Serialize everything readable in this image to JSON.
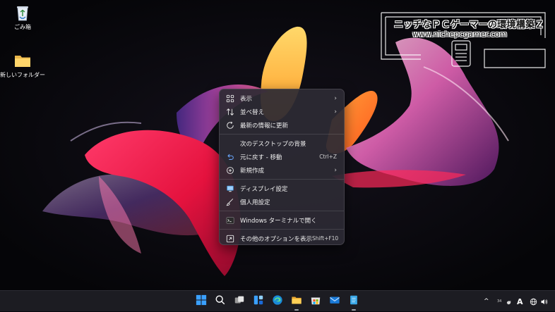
{
  "desktop": {
    "icons": [
      {
        "label": "ごみ箱",
        "icon": "recycle-bin-icon"
      },
      {
        "label": "新しいフォルダー",
        "icon": "folder-icon"
      }
    ]
  },
  "watermark": {
    "title": "ニッチなＰＣゲーマーの環境構築Ｚ",
    "url": "www.nichepcgamer.com"
  },
  "context_menu": {
    "items": [
      {
        "label": "表示",
        "icon": "grid-icon",
        "submenu": true
      },
      {
        "label": "並べ替え",
        "icon": "sort-icon",
        "submenu": true
      },
      {
        "label": "最新の情報に更新",
        "icon": "refresh-icon"
      },
      {
        "label": "次のデスクトップの背景",
        "icon": ""
      },
      {
        "label": "元に戻す - 移動",
        "icon": "undo-icon",
        "accelerator": "Ctrl+Z"
      },
      {
        "label": "新規作成",
        "icon": "new-icon",
        "submenu": true
      },
      {
        "label": "ディスプレイ設定",
        "icon": "display-icon"
      },
      {
        "label": "個人用設定",
        "icon": "brush-icon"
      },
      {
        "label": "Windows ターミナルで開く",
        "icon": "terminal-icon"
      },
      {
        "label": "その他のオプションを表示",
        "icon": "more-options-icon",
        "accelerator": "Shift+F10"
      }
    ],
    "submenu_arrow": "›"
  },
  "taskbar": {
    "apps": [
      "windows-start-icon",
      "search-icon",
      "task-view-icon",
      "widgets-icon",
      "edge-icon",
      "file-explorer-icon",
      "store-icon",
      "mail-icon",
      "notepad-icon"
    ],
    "tray": {
      "chevron": "^",
      "badge": "34",
      "ime": "A",
      "colors": {
        "bg": "#1c1c22",
        "accent": "#0a84ff"
      }
    }
  }
}
